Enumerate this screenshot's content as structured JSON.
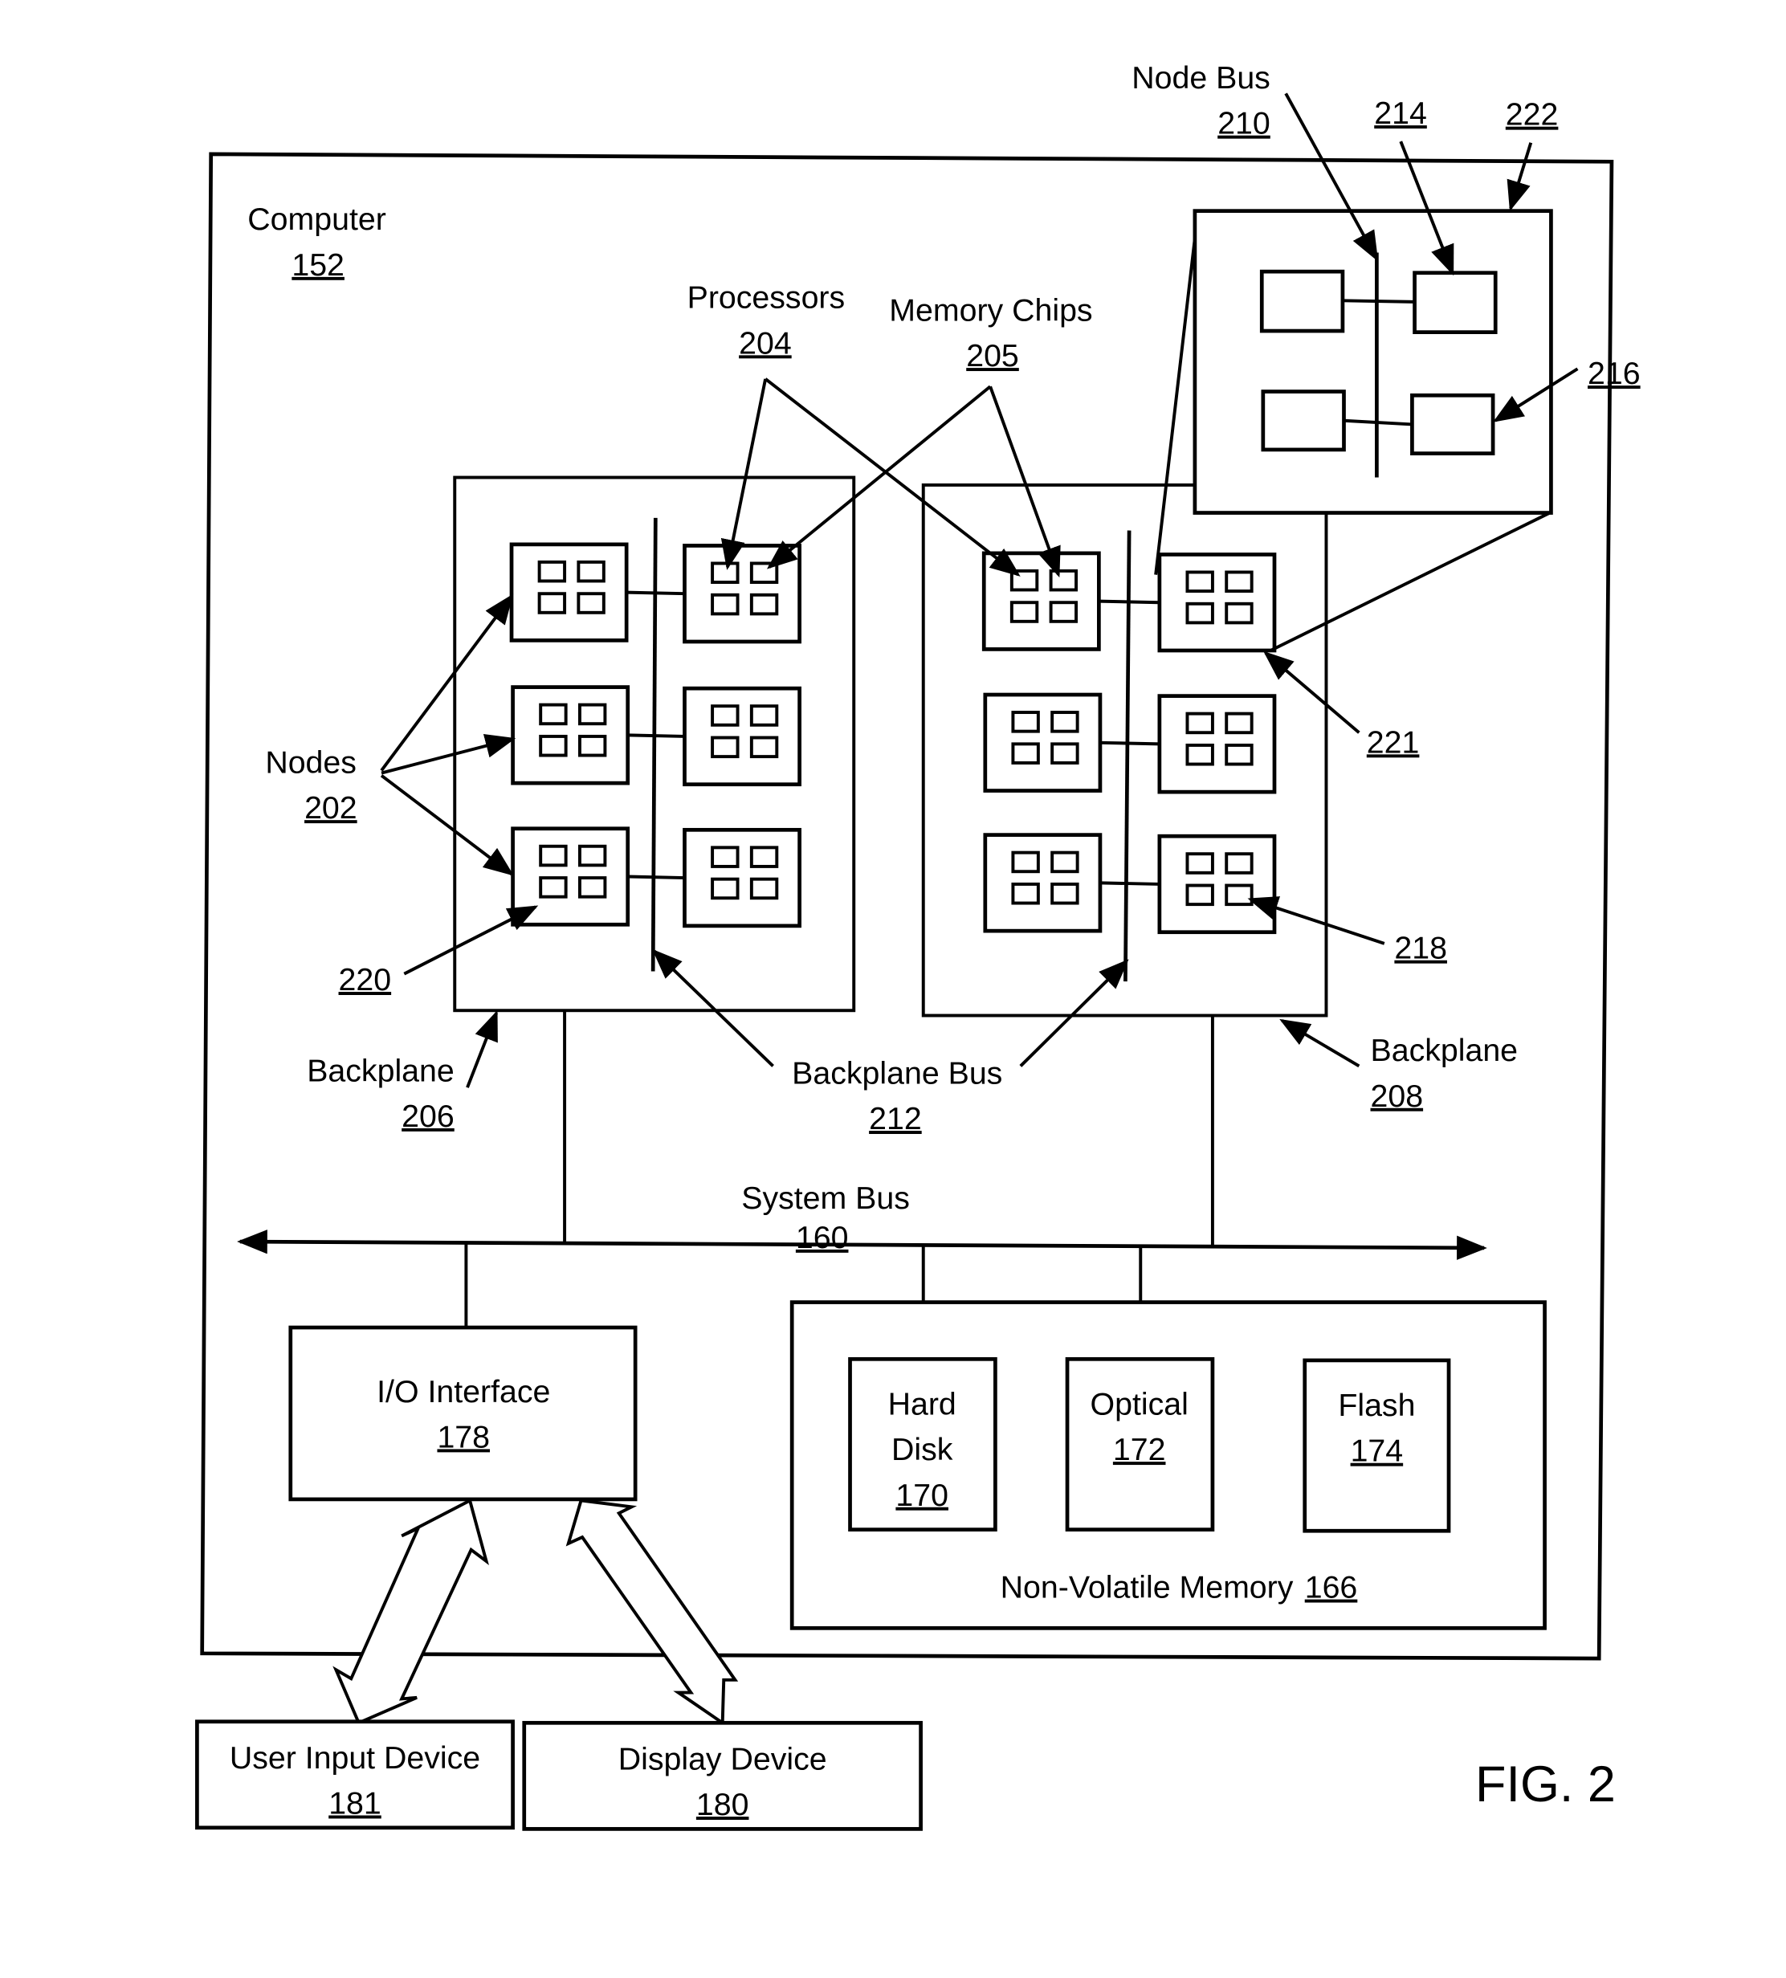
{
  "figure_label": "FIG. 2",
  "computer": {
    "label": "Computer",
    "ref": "152"
  },
  "processors": {
    "label": "Processors",
    "ref": "204"
  },
  "memory_chips": {
    "label": "Memory Chips",
    "ref": "205"
  },
  "node_bus": {
    "label": "Node Bus",
    "ref": "210"
  },
  "refs": {
    "r214": "214",
    "r222": "222",
    "r216": "216",
    "r221": "221",
    "r218": "218",
    "r220": "220"
  },
  "nodes": {
    "label": "Nodes",
    "ref": "202"
  },
  "backplane_left": {
    "label": "Backplane",
    "ref": "206"
  },
  "backplane_right": {
    "label": "Backplane",
    "ref": "208"
  },
  "backplane_bus": {
    "label": "Backplane Bus",
    "ref": "212"
  },
  "system_bus": {
    "label": "System Bus",
    "ref": "160"
  },
  "io_interface": {
    "label": "I/O Interface",
    "ref": "178"
  },
  "nvm": {
    "label": "Non-Volatile Memory",
    "ref": "166"
  },
  "hard_disk": {
    "label1": "Hard",
    "label2": "Disk",
    "ref": "170"
  },
  "optical": {
    "label": "Optical",
    "ref": "172"
  },
  "flash": {
    "label": "Flash",
    "ref": "174"
  },
  "user_input": {
    "label": "User Input Device",
    "ref": "181"
  },
  "display": {
    "label": "Display Device",
    "ref": "180"
  }
}
